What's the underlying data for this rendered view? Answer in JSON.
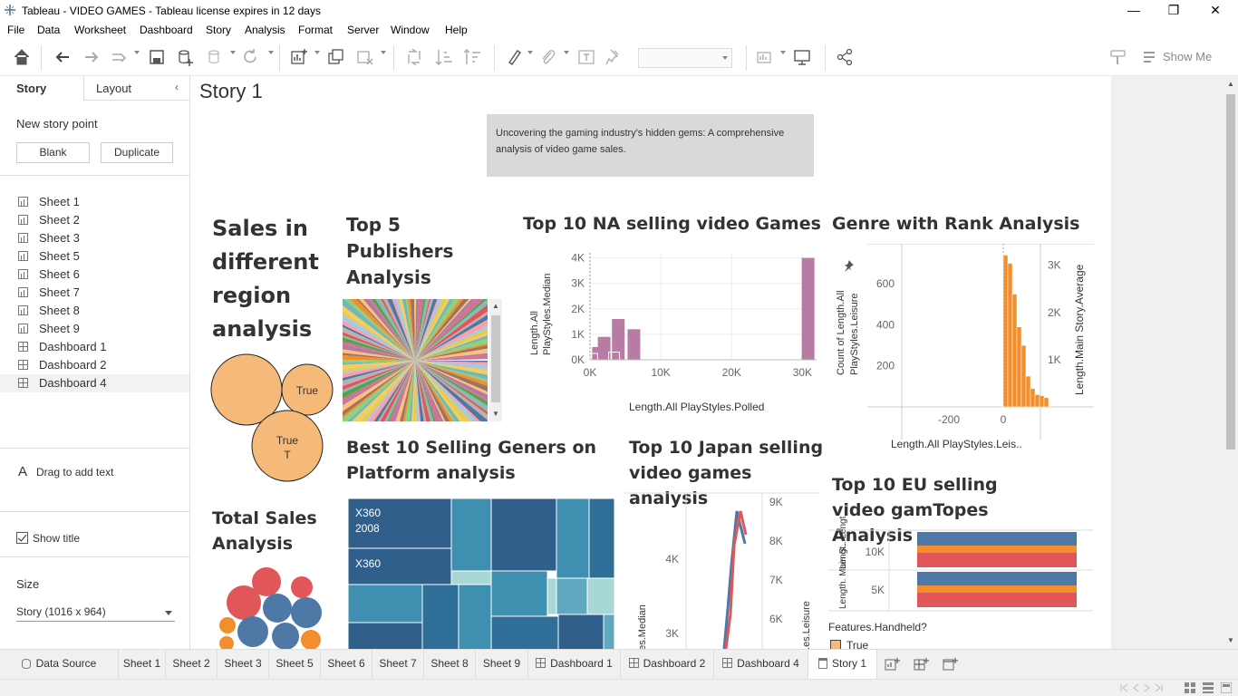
{
  "window": {
    "title": "Tableau - VIDEO GAMES - Tableau license expires in 12 days",
    "minimize": "—",
    "restore": "❐",
    "close": "✕"
  },
  "menu": [
    "File",
    "Data",
    "Worksheet",
    "Dashboard",
    "Story",
    "Analysis",
    "Format",
    "Server",
    "Window",
    "Help"
  ],
  "toolbar": {
    "show_me": "Show Me"
  },
  "sidebar": {
    "tab_story": "Story",
    "tab_layout": "Layout",
    "new_story_point": "New story point",
    "blank": "Blank",
    "duplicate": "Duplicate",
    "items": [
      {
        "label": "Sheet 1",
        "type": "worksheet"
      },
      {
        "label": "Sheet 2",
        "type": "worksheet"
      },
      {
        "label": "Sheet 3",
        "type": "worksheet"
      },
      {
        "label": "Sheet 5",
        "type": "worksheet"
      },
      {
        "label": "Sheet 6",
        "type": "worksheet"
      },
      {
        "label": "Sheet 7",
        "type": "worksheet"
      },
      {
        "label": "Sheet 8",
        "type": "worksheet"
      },
      {
        "label": "Sheet 9",
        "type": "worksheet"
      },
      {
        "label": "Dashboard 1",
        "type": "dashboard"
      },
      {
        "label": "Dashboard 2",
        "type": "dashboard"
      },
      {
        "label": "Dashboard 4",
        "type": "dashboard",
        "selected": true
      }
    ],
    "drag_text": "Drag to add text",
    "show_title": "Show title",
    "size_label": "Size",
    "size_value": "Story (1016 x 964)"
  },
  "story": {
    "title": "Story 1",
    "caption": "Uncovering the gaming industry's hidden  gems: A comprehensive  analysis of  video game sales.",
    "sales_region": {
      "title": "Sales in different region analysis",
      "bubble_labels": [
        "True",
        "True",
        "T"
      ]
    },
    "publishers": {
      "title": "Top  5 Publishers Analysis"
    },
    "na": {
      "title": "Top 10 NA  selling video Games",
      "y_label_1": "Length.All",
      "y_label_2": "PlayStyles.Median",
      "y_ticks": [
        "4K",
        "3K",
        "2K",
        "1K",
        "0K"
      ],
      "x_ticks": [
        "0K",
        "10K",
        "20K",
        "30K"
      ],
      "x_label": "Length.All PlayStyles.Polled"
    },
    "genre": {
      "title": "Genre with Rank Analysis",
      "y_left_1": "Count of Length.All",
      "y_left_2": "PlayStyles.Leisure",
      "y_left_ticks": [
        "600",
        "400",
        "200"
      ],
      "y_right_ticks": [
        "3K",
        "2K",
        "1K"
      ],
      "y_right_label": "Length.Main Story.Average",
      "x_ticks": [
        "-200",
        "0"
      ],
      "x_label": "Length.All PlayStyles.Leis.."
    },
    "best10": {
      "title": " Best 10 Selling Geners on Platform analysis",
      "tile_labels": [
        "X360",
        "2008",
        "X360"
      ]
    },
    "japan": {
      "title": "Top 10 Japan selling video games analysis",
      "y_left_ticks": [
        "4K",
        "3K"
      ],
      "y_right_ticks": [
        "9K",
        "8K",
        "7K",
        "6K"
      ],
      "y_left_label": "..es.Median",
      "y_right_label": "..es.Leisure"
    },
    "eu": {
      "title": "Top 10 EU selling video gamTopes Analysis",
      "y_ticks": [
        "10K",
        "5K"
      ],
      "row_labels": [
        "Lengt.. Lengt..",
        "Length. Main S.."
      ],
      "legend_title": "Features.Handheld?",
      "legend_item": "True"
    },
    "total_sales": {
      "title": "Total Sales Analysis"
    }
  },
  "tabs": [
    {
      "label": "Data Source"
    },
    {
      "label": "Sheet 1"
    },
    {
      "label": "Sheet 2"
    },
    {
      "label": "Sheet 3"
    },
    {
      "label": "Sheet 5"
    },
    {
      "label": "Sheet 6"
    },
    {
      "label": "Sheet 7"
    },
    {
      "label": "Sheet 8"
    },
    {
      "label": "Sheet 9"
    },
    {
      "label": "Dashboard 1"
    },
    {
      "label": "Dashboard 2"
    },
    {
      "label": "Dashboard 4"
    },
    {
      "label": "Story 1",
      "selected": true
    }
  ],
  "colors": {
    "accent_orange": "#f5b97a",
    "bar_purple": "#b77ba4",
    "genre_orange": "#f28e2b",
    "treemap_dark": "#2f5f8a",
    "treemap_mid": "#3f8fb0",
    "eu_blue": "#4e79a7",
    "eu_red": "#e15759"
  }
}
